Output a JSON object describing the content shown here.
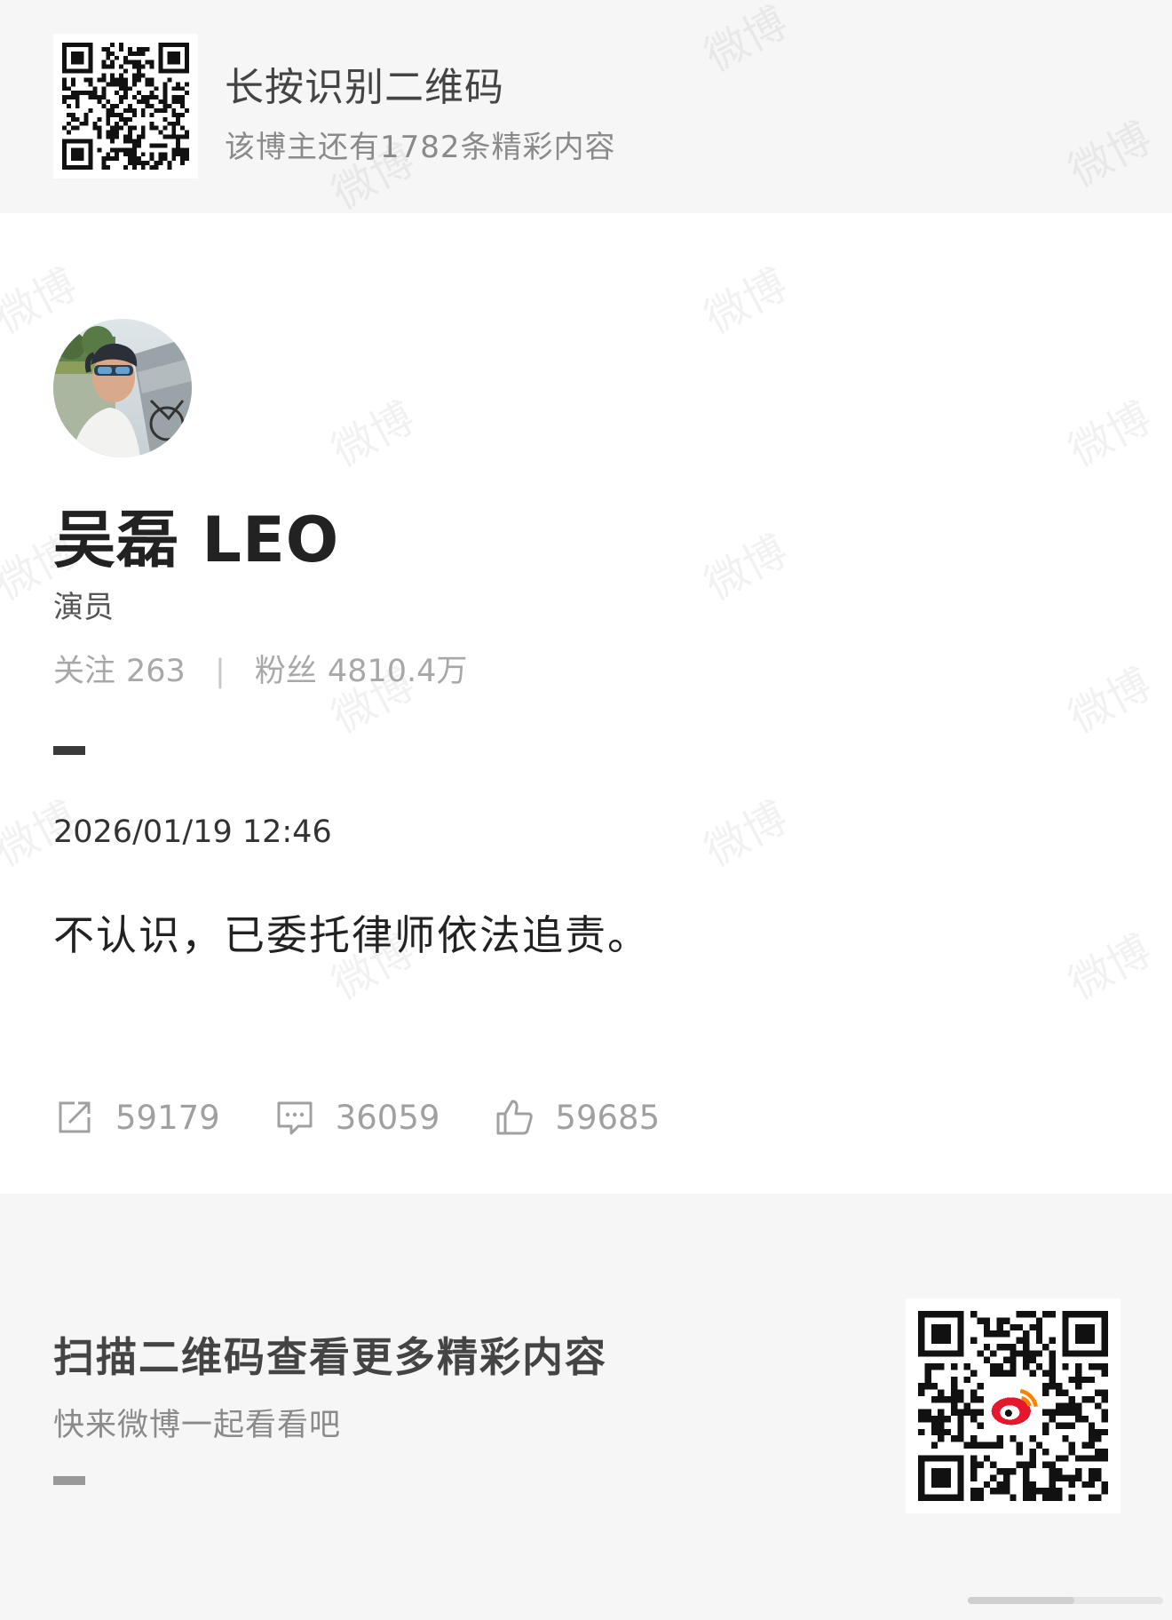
{
  "header": {
    "title": "长按识别二维码",
    "subtitle": "该博主还有1782条精彩内容"
  },
  "profile": {
    "name": "吴磊 LEO",
    "role": "演员",
    "following_label": "关注",
    "following_count": "263",
    "followers_label": "粉丝",
    "followers_count": "4810.4万"
  },
  "post": {
    "timestamp": "2026/01/19 12:46",
    "text": "不认识，已委托律师依法追责。",
    "reposts": "59179",
    "comments": "36059",
    "likes": "59685"
  },
  "footer": {
    "title": "扫描二维码查看更多精彩内容",
    "subtitle": "快来微博一起看看吧"
  },
  "watermark": {
    "text": "微博"
  },
  "icons": {
    "repost": "repost-icon",
    "comment": "comment-icon",
    "like": "thumbs-up-icon",
    "qr": "qr-code-icon",
    "weibo": "weibo-logo-icon"
  },
  "colors": {
    "band_background": "#f6f6f6",
    "muted_text": "#a0a0a0",
    "weibo_red": "#e6162d",
    "weibo_orange": "#ff8200"
  }
}
